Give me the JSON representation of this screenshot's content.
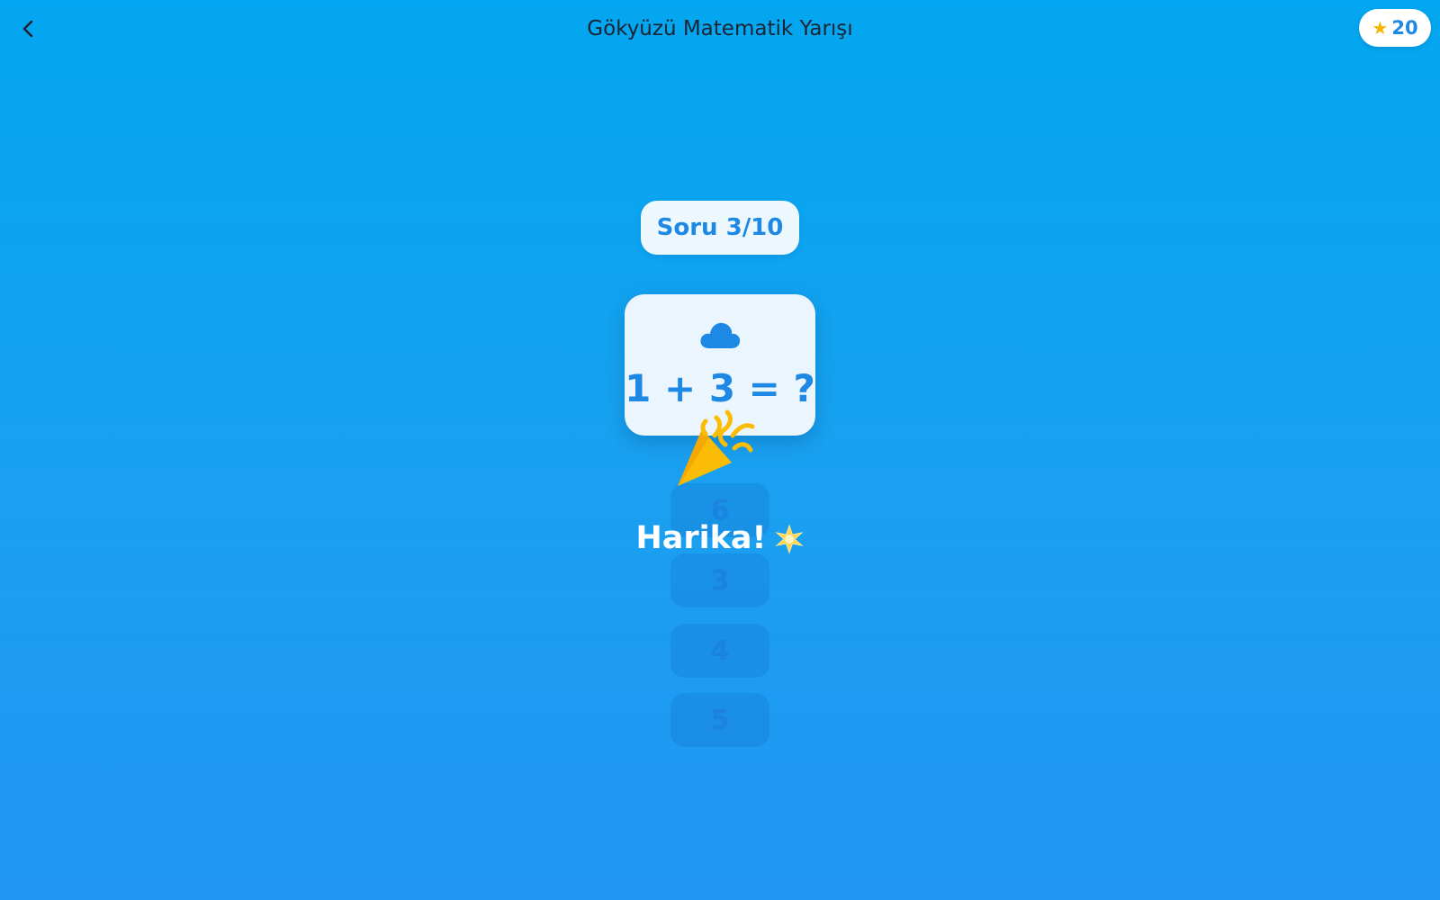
{
  "header": {
    "back_icon": "chevron-left-icon",
    "title": "Gökyüzü Matematik Yarışı",
    "score_icon": "star-icon",
    "score": "20"
  },
  "question": {
    "progress_label": "Soru 3/10",
    "current": 3,
    "total": 10,
    "icon": "cloud-icon",
    "equation": "1 + 3 = ?"
  },
  "answers": [
    {
      "label": "6"
    },
    {
      "label": "3"
    },
    {
      "label": "4"
    },
    {
      "label": "5"
    }
  ],
  "feedback": {
    "text": "Harika!",
    "icon": "sparkle-icon",
    "celebration_icon": "party-popper-icon"
  },
  "colors": {
    "background_top": "#03a6f0",
    "background_bottom": "#2196f3",
    "accent_blue": "#1e88e5",
    "star_yellow": "#f7b500",
    "popper_yellow": "#fbbc05"
  }
}
